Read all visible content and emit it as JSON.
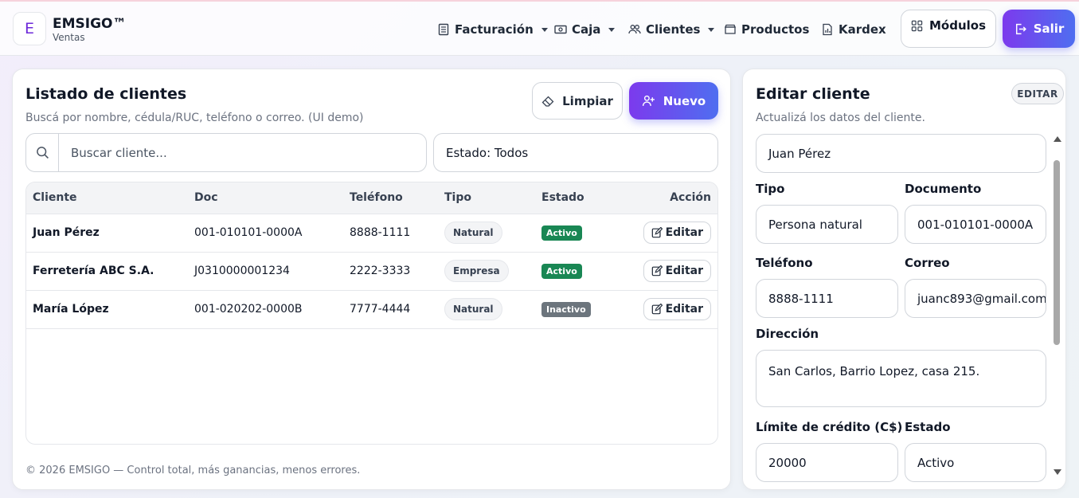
{
  "header": {
    "logo_letter": "E",
    "brand_name": "EMSIGO™",
    "brand_sub": "Ventas",
    "nav": [
      {
        "label": "Facturación",
        "icon": "receipt-icon",
        "dropdown": true
      },
      {
        "label": "Caja",
        "icon": "cash-icon",
        "dropdown": true
      },
      {
        "label": "Clientes",
        "icon": "people-icon",
        "dropdown": true
      },
      {
        "label": "Productos",
        "icon": "box-icon",
        "dropdown": false
      },
      {
        "label": "Kardex",
        "icon": "report-icon",
        "dropdown": false
      }
    ],
    "modulos_label": "Módulos",
    "salir_label": "Salir"
  },
  "list": {
    "title": "Listado de clientes",
    "subtitle": "Buscá por nombre, cédula/RUC, teléfono o correo. (UI demo)",
    "limpiar_label": "Limpiar",
    "nuevo_label": "Nuevo",
    "search_placeholder": "Buscar cliente...",
    "estado_filter": "Estado: Todos",
    "columns": [
      "Cliente",
      "Doc",
      "Teléfono",
      "Tipo",
      "Estado",
      "Acción"
    ],
    "rows": [
      {
        "cliente": "Juan Pérez",
        "doc": "001-010101-0000A",
        "telefono": "8888-1111",
        "tipo": "Natural",
        "estado": "Activo",
        "accion": "Editar"
      },
      {
        "cliente": "Ferretería ABC S.A.",
        "doc": "J0310000001234",
        "telefono": "2222-3333",
        "tipo": "Empresa",
        "estado": "Activo",
        "accion": "Editar"
      },
      {
        "cliente": "María López",
        "doc": "001-020202-0000B",
        "telefono": "7777-4444",
        "tipo": "Natural",
        "estado": "Inactivo",
        "accion": "Editar"
      }
    ],
    "footer": "© 2026 EMSIGO — Control total, más ganancias, menos errores."
  },
  "edit": {
    "title": "Editar cliente",
    "subtitle": "Actualizá los datos del cliente.",
    "badge": "EDITAR",
    "nombre_value": "Juan Pérez",
    "tipo_label": "Tipo",
    "tipo_value": "Persona natural",
    "documento_label": "Documento",
    "documento_value": "001-010101-0000A",
    "telefono_label": "Teléfono",
    "telefono_value": "8888-1111",
    "correo_label": "Correo",
    "correo_value": "juanc893@gmail.com",
    "direccion_label": "Dirección",
    "direccion_value": "San Carlos, Barrio Lopez, casa 215.",
    "limite_label": "Límite de crédito (C$)",
    "limite_value": "20000",
    "estado_label": "Estado",
    "estado_value": "Activo"
  },
  "colors": {
    "accent_start": "#7c3aed",
    "accent_end": "#4f6ef0",
    "activo": "#198754",
    "inactivo": "#6c757d"
  }
}
